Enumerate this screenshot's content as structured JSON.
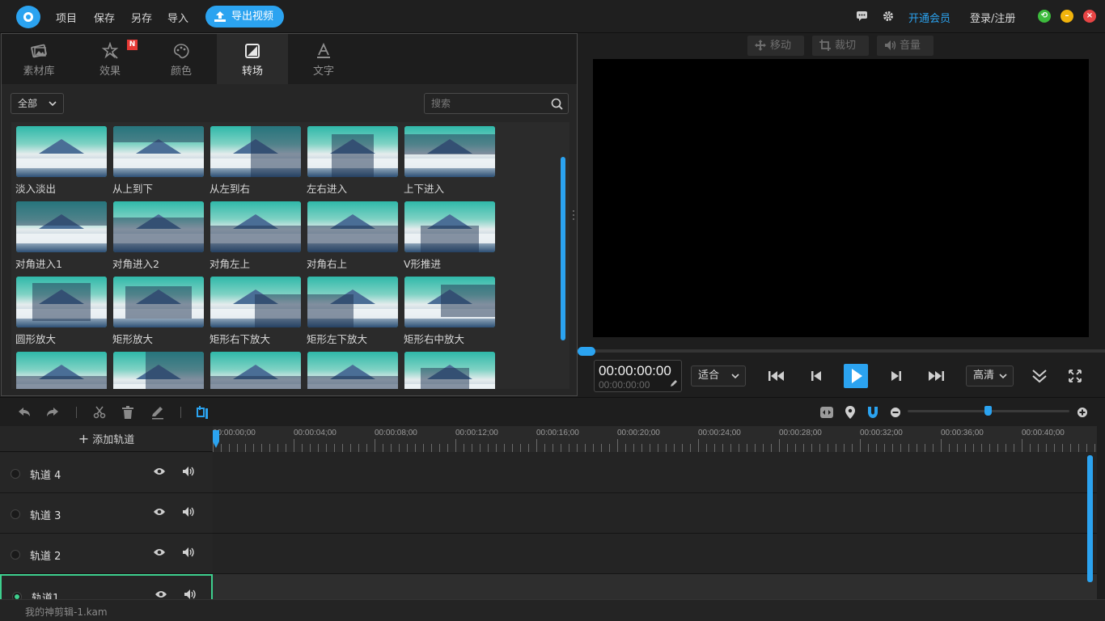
{
  "menu": {
    "project": "项目",
    "save": "保存",
    "save_as": "另存",
    "import": "导入",
    "export": "导出视频"
  },
  "topright": {
    "vip": "开通会员",
    "login": "登录/注册"
  },
  "tabs": [
    {
      "label": "素材库",
      "icon": "media-library-icon"
    },
    {
      "label": "效果",
      "icon": "effects-icon"
    },
    {
      "label": "颜色",
      "icon": "color-palette-icon"
    },
    {
      "label": "转场",
      "icon": "transition-icon"
    },
    {
      "label": "文字",
      "icon": "text-icon"
    }
  ],
  "new_badge": "N",
  "filter": {
    "selected": "全部"
  },
  "search": {
    "placeholder": "搜索"
  },
  "transitions": [
    [
      "淡入淡出",
      "从上到下",
      "从左到右",
      "左右进入",
      "上下进入"
    ],
    [
      "对角进入1",
      "对角进入2",
      "对角左上",
      "对角右上",
      "V形推进"
    ],
    [
      "圆形放大",
      "矩形放大",
      "矩形右下放大",
      "矩形左下放大",
      "矩形右中放大"
    ],
    [
      "",
      "",
      "",
      "",
      ""
    ]
  ],
  "preview": {
    "move": "移动",
    "crop": "裁切",
    "volume": "音量",
    "time_main": "00:00:00:00",
    "time_sub": "00:00:00:00",
    "fit": "适合",
    "quality": "高清"
  },
  "timeline": {
    "add_track": "添加轨道",
    "ruler": [
      "00:00:00;00",
      "00:00:04;00",
      "00:00:08;00",
      "00:00:12;00",
      "00:00:16;00",
      "00:00:20;00",
      "00:00:24;00",
      "00:00:28;00",
      "00:00:32;00",
      "00:00:36;00",
      "00:00:40;00"
    ],
    "tracks": [
      "轨道 4",
      "轨道 3",
      "轨道 2",
      "轨道1"
    ]
  },
  "status": {
    "filename": "我的神剪辑-1.kam"
  },
  "colors": {
    "accent": "#2ba3f0",
    "selected_track": "#3ecf8e",
    "badge": "#e53935"
  }
}
